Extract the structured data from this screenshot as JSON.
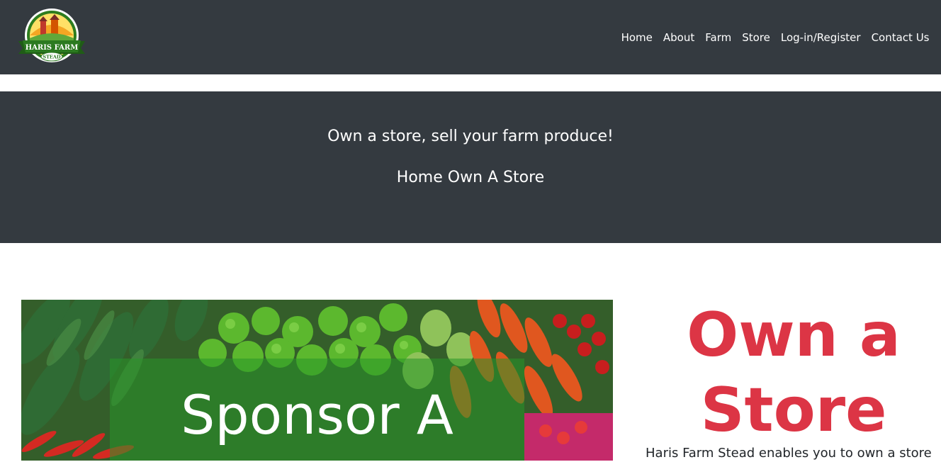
{
  "brand": {
    "logo_top": "HARIS FARM",
    "logo_bottom": "STEAD"
  },
  "nav": {
    "items": [
      {
        "label": "Home"
      },
      {
        "label": "About"
      },
      {
        "label": "Farm"
      },
      {
        "label": "Store"
      },
      {
        "label": "Log-in/Register"
      },
      {
        "label": "Contact Us"
      }
    ]
  },
  "hero": {
    "tagline": "Own a store, sell your farm produce!",
    "breadcrumb": {
      "home": "Home",
      "current": "Own A Store"
    }
  },
  "feature": {
    "image_caption": "Sponsor A",
    "title_line1": "Own a",
    "title_line2": "Store",
    "intro": "Haris Farm Stead enables you to own a store"
  },
  "colors": {
    "navbar_bg": "#343a40",
    "accent_red": "#dc3545",
    "overlay_green": "#289628"
  }
}
